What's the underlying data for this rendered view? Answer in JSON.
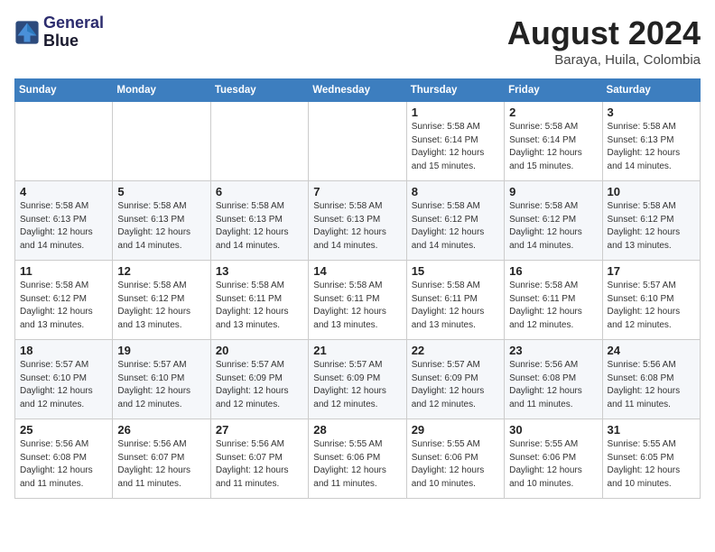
{
  "logo": {
    "line1": "General",
    "line2": "Blue"
  },
  "title": {
    "month_year": "August 2024",
    "location": "Baraya, Huila, Colombia"
  },
  "headers": [
    "Sunday",
    "Monday",
    "Tuesday",
    "Wednesday",
    "Thursday",
    "Friday",
    "Saturday"
  ],
  "weeks": [
    [
      {
        "day": "",
        "info": ""
      },
      {
        "day": "",
        "info": ""
      },
      {
        "day": "",
        "info": ""
      },
      {
        "day": "",
        "info": ""
      },
      {
        "day": "1",
        "info": "Sunrise: 5:58 AM\nSunset: 6:14 PM\nDaylight: 12 hours\nand 15 minutes."
      },
      {
        "day": "2",
        "info": "Sunrise: 5:58 AM\nSunset: 6:14 PM\nDaylight: 12 hours\nand 15 minutes."
      },
      {
        "day": "3",
        "info": "Sunrise: 5:58 AM\nSunset: 6:13 PM\nDaylight: 12 hours\nand 14 minutes."
      }
    ],
    [
      {
        "day": "4",
        "info": "Sunrise: 5:58 AM\nSunset: 6:13 PM\nDaylight: 12 hours\nand 14 minutes."
      },
      {
        "day": "5",
        "info": "Sunrise: 5:58 AM\nSunset: 6:13 PM\nDaylight: 12 hours\nand 14 minutes."
      },
      {
        "day": "6",
        "info": "Sunrise: 5:58 AM\nSunset: 6:13 PM\nDaylight: 12 hours\nand 14 minutes."
      },
      {
        "day": "7",
        "info": "Sunrise: 5:58 AM\nSunset: 6:13 PM\nDaylight: 12 hours\nand 14 minutes."
      },
      {
        "day": "8",
        "info": "Sunrise: 5:58 AM\nSunset: 6:12 PM\nDaylight: 12 hours\nand 14 minutes."
      },
      {
        "day": "9",
        "info": "Sunrise: 5:58 AM\nSunset: 6:12 PM\nDaylight: 12 hours\nand 14 minutes."
      },
      {
        "day": "10",
        "info": "Sunrise: 5:58 AM\nSunset: 6:12 PM\nDaylight: 12 hours\nand 13 minutes."
      }
    ],
    [
      {
        "day": "11",
        "info": "Sunrise: 5:58 AM\nSunset: 6:12 PM\nDaylight: 12 hours\nand 13 minutes."
      },
      {
        "day": "12",
        "info": "Sunrise: 5:58 AM\nSunset: 6:12 PM\nDaylight: 12 hours\nand 13 minutes."
      },
      {
        "day": "13",
        "info": "Sunrise: 5:58 AM\nSunset: 6:11 PM\nDaylight: 12 hours\nand 13 minutes."
      },
      {
        "day": "14",
        "info": "Sunrise: 5:58 AM\nSunset: 6:11 PM\nDaylight: 12 hours\nand 13 minutes."
      },
      {
        "day": "15",
        "info": "Sunrise: 5:58 AM\nSunset: 6:11 PM\nDaylight: 12 hours\nand 13 minutes."
      },
      {
        "day": "16",
        "info": "Sunrise: 5:58 AM\nSunset: 6:11 PM\nDaylight: 12 hours\nand 12 minutes."
      },
      {
        "day": "17",
        "info": "Sunrise: 5:57 AM\nSunset: 6:10 PM\nDaylight: 12 hours\nand 12 minutes."
      }
    ],
    [
      {
        "day": "18",
        "info": "Sunrise: 5:57 AM\nSunset: 6:10 PM\nDaylight: 12 hours\nand 12 minutes."
      },
      {
        "day": "19",
        "info": "Sunrise: 5:57 AM\nSunset: 6:10 PM\nDaylight: 12 hours\nand 12 minutes."
      },
      {
        "day": "20",
        "info": "Sunrise: 5:57 AM\nSunset: 6:09 PM\nDaylight: 12 hours\nand 12 minutes."
      },
      {
        "day": "21",
        "info": "Sunrise: 5:57 AM\nSunset: 6:09 PM\nDaylight: 12 hours\nand 12 minutes."
      },
      {
        "day": "22",
        "info": "Sunrise: 5:57 AM\nSunset: 6:09 PM\nDaylight: 12 hours\nand 12 minutes."
      },
      {
        "day": "23",
        "info": "Sunrise: 5:56 AM\nSunset: 6:08 PM\nDaylight: 12 hours\nand 11 minutes."
      },
      {
        "day": "24",
        "info": "Sunrise: 5:56 AM\nSunset: 6:08 PM\nDaylight: 12 hours\nand 11 minutes."
      }
    ],
    [
      {
        "day": "25",
        "info": "Sunrise: 5:56 AM\nSunset: 6:08 PM\nDaylight: 12 hours\nand 11 minutes."
      },
      {
        "day": "26",
        "info": "Sunrise: 5:56 AM\nSunset: 6:07 PM\nDaylight: 12 hours\nand 11 minutes."
      },
      {
        "day": "27",
        "info": "Sunrise: 5:56 AM\nSunset: 6:07 PM\nDaylight: 12 hours\nand 11 minutes."
      },
      {
        "day": "28",
        "info": "Sunrise: 5:55 AM\nSunset: 6:06 PM\nDaylight: 12 hours\nand 11 minutes."
      },
      {
        "day": "29",
        "info": "Sunrise: 5:55 AM\nSunset: 6:06 PM\nDaylight: 12 hours\nand 10 minutes."
      },
      {
        "day": "30",
        "info": "Sunrise: 5:55 AM\nSunset: 6:06 PM\nDaylight: 12 hours\nand 10 minutes."
      },
      {
        "day": "31",
        "info": "Sunrise: 5:55 AM\nSunset: 6:05 PM\nDaylight: 12 hours\nand 10 minutes."
      }
    ]
  ]
}
